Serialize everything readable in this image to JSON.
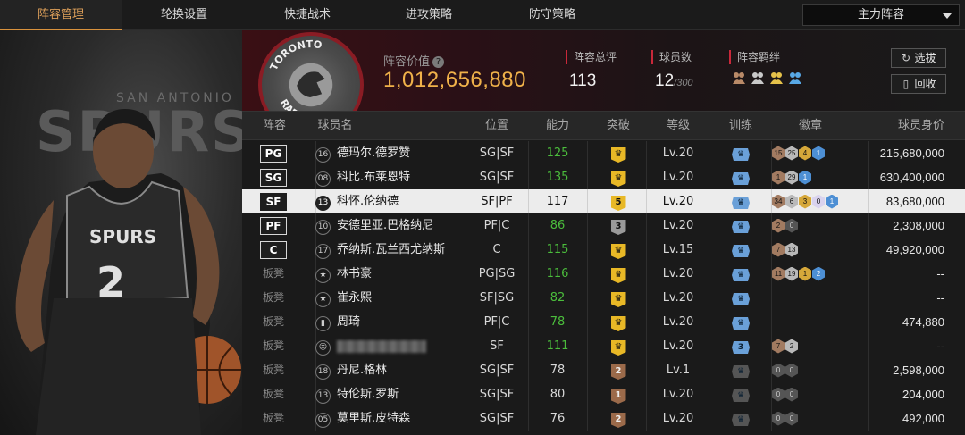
{
  "tabs": [
    {
      "label": "阵容管理",
      "active": true
    },
    {
      "label": "轮换设置",
      "active": false
    },
    {
      "label": "快捷战术",
      "active": false
    },
    {
      "label": "进攻策略",
      "active": false
    },
    {
      "label": "防守策略",
      "active": false
    }
  ],
  "lineup_select": {
    "value": "主力阵容"
  },
  "art": {
    "jersey_name": "SPURS",
    "jersey_number": "2",
    "backdrop_text": "SPURS",
    "backdrop_small": "SAN ANTONIO"
  },
  "team": {
    "logo_text": "TORONTO RAPTORS",
    "value_label": "阵容价值",
    "value": "1,012,656,880",
    "rating_label": "阵容总评",
    "rating": "113",
    "count_label": "球员数",
    "count": "12",
    "count_max": "/300",
    "bond_label": "阵容羁绊",
    "bond_icons": [
      "bond-icon-1",
      "bond-icon-2",
      "bond-icon-3",
      "bond-icon-4"
    ],
    "buttons": {
      "select": "选拔",
      "recycle": "回收"
    }
  },
  "table": {
    "headers": {
      "slot": "阵容",
      "name": "球员名",
      "pos": "位置",
      "ability": "能力",
      "breakthrough": "突破",
      "level": "等级",
      "training": "训练",
      "badges": "徽章",
      "value": "球员身价"
    },
    "rows": [
      {
        "slot": "PG",
        "starter": true,
        "icon": "16",
        "name": "德玛尔.德罗赞",
        "pos": "SG|SF",
        "ability": "125",
        "ability_green": true,
        "brk": "",
        "brk_type": "gold",
        "level": "Lv.20",
        "training": "",
        "training_on": true,
        "badges": [
          {
            "t": "15",
            "c": "b-bronze"
          },
          {
            "t": "25",
            "c": "b-silver"
          },
          {
            "t": "4",
            "c": "b-gold"
          },
          {
            "t": "1",
            "c": "b-blue"
          }
        ],
        "value": "215,680,000"
      },
      {
        "slot": "SG",
        "starter": true,
        "icon": "08",
        "name": "科比.布莱恩特",
        "pos": "SG|SF",
        "ability": "135",
        "ability_green": true,
        "brk": "",
        "brk_type": "gold",
        "level": "Lv.20",
        "training": "",
        "training_on": true,
        "badges": [
          {
            "t": "1",
            "c": "b-bronze"
          },
          {
            "t": "29",
            "c": "b-silver"
          },
          {
            "t": "1",
            "c": "b-blue"
          }
        ],
        "value": "630,400,000"
      },
      {
        "slot": "SF",
        "starter": true,
        "highlight": true,
        "icon": "13",
        "name": "科怀.伦纳德",
        "pos": "SF|PF",
        "ability": "117",
        "ability_green": false,
        "brk": "5",
        "brk_type": "gold",
        "level": "Lv.20",
        "training": "",
        "training_on": true,
        "badges": [
          {
            "t": "34",
            "c": "b-bronze"
          },
          {
            "t": "6",
            "c": "b-silver"
          },
          {
            "t": "3",
            "c": "b-gold"
          },
          {
            "t": "0",
            "c": "b-purple"
          },
          {
            "t": "1",
            "c": "b-blue"
          }
        ],
        "value": "83,680,000"
      },
      {
        "slot": "PF",
        "starter": true,
        "icon": "10",
        "name": "安德里亚.巴格纳尼",
        "pos": "PF|C",
        "ability": "86",
        "ability_green": true,
        "brk": "3",
        "brk_type": "gray",
        "level": "Lv.20",
        "training": "",
        "training_on": true,
        "badges": [
          {
            "t": "2",
            "c": "b-bronze"
          },
          {
            "t": "0",
            "c": "b-dark"
          }
        ],
        "value": "2,308,000"
      },
      {
        "slot": "C",
        "starter": true,
        "icon": "17",
        "name": "乔纳斯.瓦兰西尤纳斯",
        "pos": "C",
        "ability": "115",
        "ability_green": true,
        "brk": "",
        "brk_type": "gold",
        "level": "Lv.15",
        "training": "",
        "training_on": true,
        "badges": [
          {
            "t": "7",
            "c": "b-bronze"
          },
          {
            "t": "13",
            "c": "b-silver"
          }
        ],
        "value": "49,920,000"
      },
      {
        "slot": "板凳",
        "starter": false,
        "icon": "★",
        "name": "林书豪",
        "pos": "PG|SG",
        "ability": "116",
        "ability_green": true,
        "brk": "",
        "brk_type": "gold",
        "level": "Lv.20",
        "training": "",
        "training_on": true,
        "badges": [
          {
            "t": "11",
            "c": "b-bronze"
          },
          {
            "t": "19",
            "c": "b-silver"
          },
          {
            "t": "1",
            "c": "b-gold"
          },
          {
            "t": "2",
            "c": "b-blue"
          }
        ],
        "value": "--"
      },
      {
        "slot": "板凳",
        "starter": false,
        "icon": "★",
        "name": "崔永熙",
        "pos": "SF|SG",
        "ability": "82",
        "ability_green": true,
        "brk": "",
        "brk_type": "gold",
        "level": "Lv.20",
        "training": "",
        "training_on": true,
        "badges": [],
        "value": "--"
      },
      {
        "slot": "板凳",
        "starter": false,
        "icon": "▮",
        "name": "周琦",
        "pos": "PF|C",
        "ability": "78",
        "ability_green": true,
        "brk": "",
        "brk_type": "gold",
        "level": "Lv.20",
        "training": "",
        "training_on": true,
        "badges": [],
        "value": "474,880"
      },
      {
        "slot": "板凳",
        "starter": false,
        "icon": "☺",
        "name": "",
        "blurred": true,
        "pos": "SF",
        "ability": "111",
        "ability_green": true,
        "brk": "",
        "brk_type": "gold",
        "level": "Lv.20",
        "training": "3",
        "training_on": true,
        "badges": [
          {
            "t": "7",
            "c": "b-bronze"
          },
          {
            "t": "2",
            "c": "b-silver"
          }
        ],
        "value": "--"
      },
      {
        "slot": "板凳",
        "starter": false,
        "icon": "18",
        "name": "丹尼.格林",
        "pos": "SG|SF",
        "ability": "78",
        "ability_green": false,
        "brk": "2",
        "brk_type": "bronze",
        "level": "Lv.1",
        "training": "",
        "training_on": false,
        "badges": [
          {
            "t": "0",
            "c": "b-dark"
          },
          {
            "t": "0",
            "c": "b-dark"
          }
        ],
        "value": "2,598,000"
      },
      {
        "slot": "板凳",
        "starter": false,
        "icon": "13",
        "name": "特伦斯.罗斯",
        "pos": "SG|SF",
        "ability": "80",
        "ability_green": false,
        "brk": "1",
        "brk_type": "bronze",
        "level": "Lv.20",
        "training": "",
        "training_on": false,
        "badges": [
          {
            "t": "0",
            "c": "b-dark"
          },
          {
            "t": "0",
            "c": "b-dark"
          }
        ],
        "value": "204,000"
      },
      {
        "slot": "板凳",
        "starter": false,
        "icon": "05",
        "name": "莫里斯.皮特森",
        "pos": "SG|SF",
        "ability": "76",
        "ability_green": false,
        "brk": "2",
        "brk_type": "bronze",
        "level": "Lv.20",
        "training": "",
        "training_on": false,
        "badges": [
          {
            "t": "0",
            "c": "b-dark"
          },
          {
            "t": "0",
            "c": "b-dark"
          }
        ],
        "value": "492,000"
      }
    ]
  }
}
